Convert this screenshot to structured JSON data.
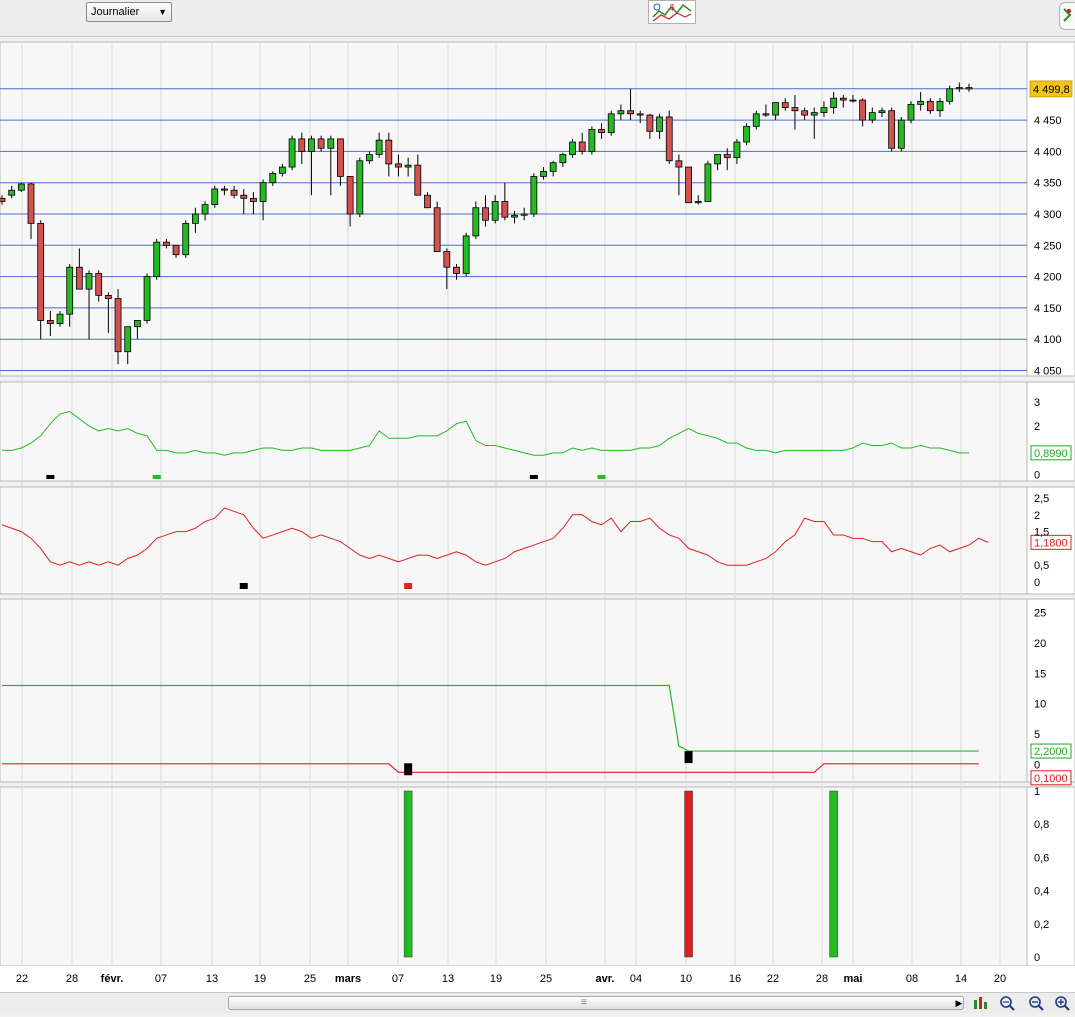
{
  "toolbar": {
    "period_label": "Journalier",
    "tool_icon": "indicators-chart-icon",
    "corner_icon": "panel-toggle-icon"
  },
  "colors": {
    "bull": "#22bb22",
    "bear": "#d25252",
    "grid": "#4a6cd4",
    "panel_bg": "#f7f7f7",
    "green_line": "#22bb22",
    "red_line": "#e02020",
    "current_price_bg": "#f4c518"
  },
  "price_panel": {
    "y_ticks": [
      "4 450",
      "4 400",
      "4 350",
      "4 300",
      "4 250",
      "4 200",
      "4 150",
      "4 100",
      "4 050"
    ],
    "current_price_label": "4 499,8"
  },
  "ind1": {
    "y_ticks": [
      "3",
      "2",
      "0"
    ],
    "current_label": "0,8990"
  },
  "ind2": {
    "y_ticks": [
      "2,5",
      "2",
      "1,5",
      "0,5",
      "0"
    ],
    "current_label": "1,1800"
  },
  "ind3": {
    "y_ticks": [
      "25",
      "20",
      "15",
      "10",
      "5",
      "0"
    ],
    "label_green": "2,2000",
    "label_red": "0,1000"
  },
  "ind4": {
    "y_ticks": [
      "1",
      "0,8",
      "0,6",
      "0,4",
      "0,2",
      "0"
    ]
  },
  "x_axis": {
    "ticks": [
      {
        "label": "22",
        "bold": false
      },
      {
        "label": "28",
        "bold": false
      },
      {
        "label": "févr.",
        "bold": true
      },
      {
        "label": "07",
        "bold": false
      },
      {
        "label": "13",
        "bold": false
      },
      {
        "label": "19",
        "bold": false
      },
      {
        "label": "25",
        "bold": false
      },
      {
        "label": "mars",
        "bold": true
      },
      {
        "label": "07",
        "bold": false
      },
      {
        "label": "13",
        "bold": false
      },
      {
        "label": "19",
        "bold": false
      },
      {
        "label": "25",
        "bold": false
      },
      {
        "label": "avr.",
        "bold": true
      },
      {
        "label": "04",
        "bold": false
      },
      {
        "label": "10",
        "bold": false
      },
      {
        "label": "16",
        "bold": false
      },
      {
        "label": "22",
        "bold": false
      },
      {
        "label": "28",
        "bold": false
      },
      {
        "label": "mai",
        "bold": true
      },
      {
        "label": "08",
        "bold": false
      },
      {
        "label": "14",
        "bold": false
      },
      {
        "label": "20",
        "bold": false
      }
    ]
  },
  "bottom_icons": [
    "scroll-right-icon",
    "auto-scale-icon",
    "zoom-fit-icon",
    "zoom-out-icon",
    "zoom-in-icon"
  ],
  "chart_data": {
    "type": "candlestick",
    "candles": [
      [
        4325,
        4330,
        4315,
        4320
      ],
      [
        4330,
        4345,
        4325,
        4338
      ],
      [
        4338,
        4350,
        4335,
        4348
      ],
      [
        4348,
        4350,
        4260,
        4285
      ],
      [
        4285,
        4290,
        4100,
        4130
      ],
      [
        4130,
        4145,
        4105,
        4125
      ],
      [
        4125,
        4145,
        4120,
        4140
      ],
      [
        4140,
        4220,
        4120,
        4215
      ],
      [
        4215,
        4245,
        4190,
        4180
      ],
      [
        4180,
        4210,
        4100,
        4205
      ],
      [
        4205,
        4210,
        4160,
        4170
      ],
      [
        4170,
        4175,
        4110,
        4165
      ],
      [
        4165,
        4180,
        4060,
        4080
      ],
      [
        4080,
        4120,
        4060,
        4120
      ],
      [
        4120,
        4130,
        4100,
        4130
      ],
      [
        4130,
        4205,
        4125,
        4200
      ],
      [
        4200,
        4260,
        4195,
        4255
      ],
      [
        4255,
        4260,
        4245,
        4250
      ],
      [
        4250,
        4245,
        4230,
        4235
      ],
      [
        4235,
        4290,
        4230,
        4285
      ],
      [
        4285,
        4310,
        4270,
        4300
      ],
      [
        4300,
        4320,
        4290,
        4315
      ],
      [
        4315,
        4345,
        4310,
        4340
      ],
      [
        4340,
        4345,
        4330,
        4338
      ],
      [
        4338,
        4345,
        4325,
        4330
      ],
      [
        4330,
        4340,
        4300,
        4325
      ],
      [
        4325,
        4335,
        4300,
        4320
      ],
      [
        4320,
        4355,
        4290,
        4350
      ],
      [
        4350,
        4368,
        4345,
        4365
      ],
      [
        4365,
        4380,
        4360,
        4375
      ],
      [
        4375,
        4425,
        4370,
        4420
      ],
      [
        4420,
        4430,
        4380,
        4400
      ],
      [
        4400,
        4425,
        4330,
        4420
      ],
      [
        4420,
        4425,
        4400,
        4405
      ],
      [
        4405,
        4425,
        4330,
        4420
      ],
      [
        4420,
        4370,
        4345,
        4360
      ],
      [
        4360,
        4360,
        4280,
        4300
      ],
      [
        4300,
        4390,
        4295,
        4385
      ],
      [
        4385,
        4400,
        4380,
        4395
      ],
      [
        4395,
        4430,
        4390,
        4418
      ],
      [
        4418,
        4430,
        4360,
        4380
      ],
      [
        4380,
        4395,
        4360,
        4375
      ],
      [
        4375,
        4390,
        4360,
        4378
      ],
      [
        4378,
        4395,
        4340,
        4330
      ],
      [
        4330,
        4335,
        4310,
        4310
      ],
      [
        4310,
        4320,
        4265,
        4240
      ],
      [
        4240,
        4245,
        4180,
        4215
      ],
      [
        4215,
        4220,
        4195,
        4205
      ],
      [
        4205,
        4270,
        4200,
        4265
      ],
      [
        4265,
        4320,
        4260,
        4310
      ],
      [
        4310,
        4330,
        4280,
        4290
      ],
      [
        4290,
        4330,
        4285,
        4320
      ],
      [
        4320,
        4350,
        4290,
        4295
      ],
      [
        4295,
        4305,
        4285,
        4298
      ],
      [
        4298,
        4310,
        4290,
        4300
      ],
      [
        4300,
        4365,
        4295,
        4360
      ],
      [
        4360,
        4375,
        4355,
        4368
      ],
      [
        4368,
        4385,
        4360,
        4382
      ],
      [
        4382,
        4398,
        4375,
        4395
      ],
      [
        4395,
        4420,
        4390,
        4415
      ],
      [
        4415,
        4430,
        4395,
        4400
      ],
      [
        4400,
        4440,
        4395,
        4435
      ],
      [
        4435,
        4445,
        4420,
        4430
      ],
      [
        4430,
        4465,
        4425,
        4460
      ],
      [
        4460,
        4475,
        4450,
        4465
      ],
      [
        4465,
        4500,
        4450,
        4460
      ],
      [
        4460,
        4465,
        4445,
        4458
      ],
      [
        4458,
        4460,
        4420,
        4432
      ],
      [
        4432,
        4460,
        4420,
        4455
      ],
      [
        4455,
        4465,
        4380,
        4385
      ],
      [
        4385,
        4395,
        4330,
        4375
      ],
      [
        4375,
        4375,
        4320,
        4318
      ],
      [
        4318,
        4330,
        4315,
        4320
      ],
      [
        4320,
        4385,
        4320,
        4380
      ],
      [
        4380,
        4395,
        4370,
        4395
      ],
      [
        4395,
        4405,
        4370,
        4390
      ],
      [
        4390,
        4420,
        4380,
        4415
      ],
      [
        4415,
        4445,
        4410,
        4440
      ],
      [
        4440,
        4465,
        4435,
        4460
      ],
      [
        4460,
        4475,
        4455,
        4458
      ],
      [
        4458,
        4475,
        4450,
        4478
      ],
      [
        4478,
        4485,
        4465,
        4470
      ],
      [
        4470,
        4490,
        4435,
        4465
      ],
      [
        4465,
        4470,
        4450,
        4458
      ],
      [
        4458,
        4470,
        4420,
        4462
      ],
      [
        4462,
        4480,
        4455,
        4470
      ],
      [
        4470,
        4495,
        4460,
        4485
      ],
      [
        4485,
        4490,
        4470,
        4482
      ],
      [
        4482,
        4490,
        4478,
        4482
      ],
      [
        4482,
        4485,
        4440,
        4450
      ],
      [
        4450,
        4470,
        4445,
        4462
      ],
      [
        4462,
        4470,
        4455,
        4465
      ],
      [
        4465,
        4470,
        4400,
        4405
      ],
      [
        4405,
        4455,
        4400,
        4450
      ],
      [
        4450,
        4480,
        4445,
        4475
      ],
      [
        4475,
        4495,
        4465,
        4480
      ],
      [
        4480,
        4485,
        4460,
        4465
      ],
      [
        4465,
        4485,
        4455,
        4480
      ],
      [
        4480,
        4505,
        4475,
        4500
      ],
      [
        4500,
        4510,
        4495,
        4502
      ],
      [
        4502,
        4508,
        4495,
        4499.8
      ]
    ],
    "ind1": [
      1.0,
      1.0,
      1.1,
      1.3,
      1.6,
      2.1,
      2.5,
      2.6,
      2.3,
      2.0,
      1.8,
      1.9,
      1.8,
      1.9,
      1.7,
      1.6,
      1.0,
      1.0,
      0.9,
      0.9,
      1.0,
      0.9,
      0.9,
      0.8,
      0.9,
      0.9,
      1.0,
      1.1,
      1.1,
      1.0,
      1.0,
      1.1,
      1.1,
      1.0,
      1.0,
      1.0,
      1.0,
      1.1,
      1.2,
      1.8,
      1.5,
      1.5,
      1.5,
      1.6,
      1.6,
      1.6,
      1.8,
      2.1,
      2.2,
      1.4,
      1.2,
      1.2,
      1.1,
      1.0,
      0.9,
      0.8,
      0.8,
      0.9,
      0.9,
      1.1,
      1.0,
      1.1,
      1.0,
      1.0,
      1.0,
      1.0,
      1.1,
      1.1,
      1.2,
      1.5,
      1.7,
      1.9,
      1.7,
      1.6,
      1.5,
      1.3,
      1.3,
      1.1,
      1.0,
      1.0,
      0.9,
      1.0,
      1.0,
      1.0,
      1.0,
      1.0,
      1.0,
      1.0,
      1.1,
      1.3,
      1.2,
      1.2,
      1.3,
      1.1,
      1.1,
      1.2,
      1.1,
      1.1,
      1.0,
      0.9,
      0.899
    ],
    "ind2": [
      1.7,
      1.6,
      1.5,
      1.3,
      1.0,
      0.6,
      0.5,
      0.6,
      0.5,
      0.6,
      0.5,
      0.6,
      0.5,
      0.7,
      0.8,
      1.0,
      1.3,
      1.4,
      1.5,
      1.5,
      1.6,
      1.8,
      1.9,
      2.2,
      2.1,
      2.0,
      1.6,
      1.3,
      1.4,
      1.5,
      1.6,
      1.5,
      1.3,
      1.4,
      1.3,
      1.2,
      1.0,
      0.8,
      0.7,
      0.8,
      0.7,
      0.6,
      0.7,
      0.8,
      0.8,
      0.7,
      0.8,
      0.9,
      0.8,
      0.6,
      0.5,
      0.6,
      0.7,
      0.9,
      1.0,
      1.1,
      1.2,
      1.3,
      1.6,
      2.0,
      2.0,
      1.8,
      1.7,
      1.9,
      1.5,
      1.8,
      1.8,
      1.9,
      1.6,
      1.4,
      1.3,
      1.0,
      0.9,
      0.8,
      0.6,
      0.5,
      0.5,
      0.5,
      0.6,
      0.7,
      0.9,
      1.2,
      1.4,
      1.9,
      1.8,
      1.8,
      1.4,
      1.4,
      1.3,
      1.3,
      1.2,
      1.2,
      0.9,
      1.0,
      0.9,
      0.8,
      1.0,
      1.1,
      0.9,
      1.0,
      1.1,
      1.3,
      1.18
    ],
    "ind3_green": [
      [
        0,
        13
      ],
      [
        69,
        13
      ],
      [
        70,
        3
      ],
      [
        71,
        2.2
      ],
      [
        101,
        2.2
      ]
    ],
    "ind3_red": [
      [
        0,
        0.1
      ],
      [
        40,
        0.1
      ],
      [
        41,
        -1.3
      ],
      [
        84,
        -1.3
      ],
      [
        85,
        0.1
      ],
      [
        101,
        0.1
      ]
    ],
    "markers_ind1": [
      {
        "i": 5,
        "c": "#000000"
      },
      {
        "i": 16,
        "c": "#22bb22"
      },
      {
        "i": 55,
        "c": "#000000"
      },
      {
        "i": 62,
        "c": "#22bb22"
      }
    ],
    "markers_ind2": [
      {
        "i": 25,
        "c": "#000000"
      },
      {
        "i": 42,
        "c": "#e02020"
      }
    ],
    "markers_ind3": [
      {
        "i": 42,
        "v": -0.8,
        "c": "#000000"
      },
      {
        "i": 71,
        "v": 1.2,
        "c": "#000000"
      }
    ],
    "ind4_bars": [
      {
        "i": 42,
        "v": 1,
        "c": "#22bb22"
      },
      {
        "i": 71,
        "v": 1,
        "c": "#e02020"
      },
      {
        "i": 86,
        "v": 1,
        "c": "#22bb22"
      }
    ]
  }
}
